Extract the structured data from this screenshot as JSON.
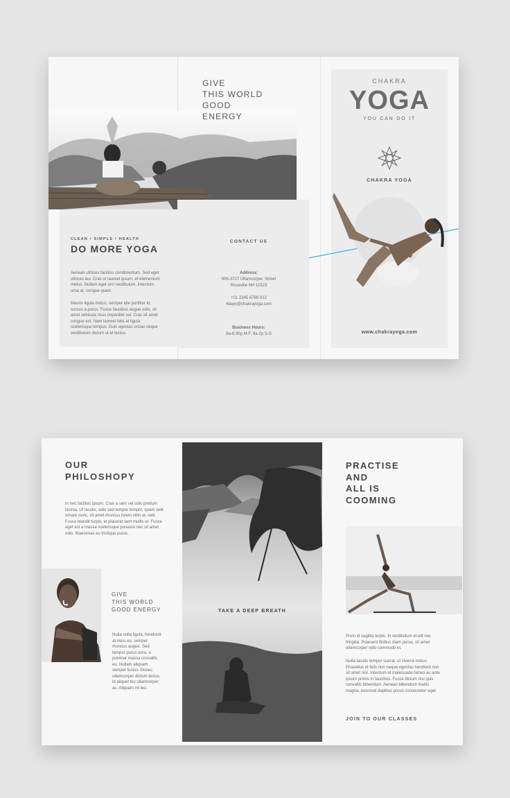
{
  "top": {
    "give_text": "GIVE\nTHIS WORLD\nGOOD\nENERGY",
    "tagline_small": "CLEAN • SIMPLE • HEALTH",
    "do_more": "DO MORE YOGA",
    "body1": "Aenean ultrices facilisis condimentum. Sed eget ultrices leo. Cras ut laoreet ipsum, et elementum metus. Nullam eget orci vestibulum, interdum urna at, congue quam.",
    "body2": "Mauris ligula metus, semper idie porttitor id, cursus a purus. Fusce faucibus augue odio, sit amet vehicula risus imperdiet vel. Cras sit amet congue est. Nam laoreet felis at ligula scelerisque tempus. Duis egestas orciac neque vestibulum dictum ut et lectus.",
    "contact_title": "CONTACT US",
    "address_label": "Address:",
    "address": "606-3727 Ullamcorper. Street\nRoseville NH 11523",
    "phone_email": "+01 2345 6789 012\n4days@chakrayoga.com",
    "hours_label": "Business Hours:",
    "hours": "8a-6:30p M-F, 9a-2p S-S",
    "chakra_small": "CHAKRA",
    "yoga_big": "YOGA",
    "you_can": "YOU CAN DO IT",
    "chakra_yoga": "CHAKRA YOGA",
    "website": "www.chakrayoga.com"
  },
  "bottom": {
    "our_philosophy": "OUR\nPHILOSHOPY",
    "philosophy_body": "In nec facilisis ipsum. Cras a sem vel odio pretium lacinia. Ut iaculis, odio sed tempor tempor, quam velit ornare nunc, sit amet rhoncus lorem nibh ac velit. Fusce blandit turpis, at placerat sem mollis ut. Fusce eget est a massa scelerisque posuere nec sit amet odio. Maecenas eu tristique purus.",
    "give_text": "GIVE\nTHIS WORLD\nGOOD ENERGY",
    "give_body": "Nulla nulla ligula, hendrerit at risus eu, semper rhoncus augue. Sed tempor purus urna, a pulvinar massa convallis eu. Nullam aliquam semper luctus. Donec ullamcorper dictum lectus, id aliquet leo ullamcorper ac. Aliquam mi leo.",
    "take_breath": "TAKE  A DEEP BREATH",
    "practise": "PRACTISE\nAND\nALL IS\nCOOMING",
    "practise_body1": "Proin id sagittis turpis. In vestibulum et elit nec fringilla. Praesent finibus diam purus, sit amet ullamcorper odio commodo et.",
    "practise_body2": "Nulla iaculis tempor suerat, ut viverra metus. Phasellus et felis non neque egestas hendrerit non sit amet nisl. Interdum et malesuada fames ac ante ipsum primis in faucibus. Fusce dictum nisi quis convallis bibendum. Aenean bibendum mattis magna, euismod dapibus purus consectetur eget.",
    "join": "JOIN TO OUR CLASSES"
  },
  "colors": {
    "accent_line": "#3aaee0",
    "background": "#e4e4e4",
    "paper": "#f7f7f7",
    "panel": "#ececec"
  }
}
